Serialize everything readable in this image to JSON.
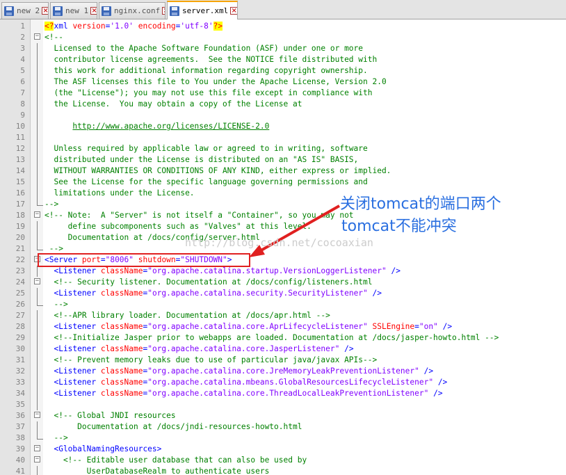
{
  "tabs": [
    {
      "label": "new 2",
      "active": false
    },
    {
      "label": "new 1",
      "active": false
    },
    {
      "label": "nginx.conf",
      "active": false
    },
    {
      "label": "server.xml",
      "active": true
    }
  ],
  "lines": [
    {
      "n": "1",
      "segs": [
        [
          "pi",
          "<?"
        ],
        [
          "tg",
          "xml "
        ],
        [
          "at",
          "version"
        ],
        [
          "tg",
          "="
        ],
        [
          "vl",
          "'1.0'"
        ],
        [
          "tg",
          " "
        ],
        [
          "at",
          "encoding"
        ],
        [
          "tg",
          "="
        ],
        [
          "vl",
          "'utf-8'"
        ],
        [
          "pi",
          "?>"
        ]
      ]
    },
    {
      "n": "2",
      "segs": [
        [
          "cm",
          "<!--"
        ]
      ]
    },
    {
      "n": "3",
      "segs": [
        [
          "cm",
          "  Licensed to the Apache Software Foundation (ASF) under one or more"
        ]
      ]
    },
    {
      "n": "4",
      "segs": [
        [
          "cm",
          "  contributor license agreements.  See the NOTICE file distributed with"
        ]
      ]
    },
    {
      "n": "5",
      "segs": [
        [
          "cm",
          "  this work for additional information regarding copyright ownership."
        ]
      ]
    },
    {
      "n": "6",
      "segs": [
        [
          "cm",
          "  The ASF licenses this file to You under the Apache License, Version 2.0"
        ]
      ]
    },
    {
      "n": "7",
      "segs": [
        [
          "cm",
          "  (the \"License\"); you may not use this file except in compliance with"
        ]
      ]
    },
    {
      "n": "8",
      "segs": [
        [
          "cm",
          "  the License.  You may obtain a copy of the License at"
        ]
      ]
    },
    {
      "n": "9",
      "segs": []
    },
    {
      "n": "10",
      "segs": [
        [
          "cm",
          "      "
        ],
        [
          "url",
          "http://www.apache.org/licenses/LICENSE-2.0"
        ]
      ]
    },
    {
      "n": "11",
      "segs": []
    },
    {
      "n": "12",
      "segs": [
        [
          "cm",
          "  Unless required by applicable law or agreed to in writing, software"
        ]
      ]
    },
    {
      "n": "13",
      "segs": [
        [
          "cm",
          "  distributed under the License is distributed on an \"AS IS\" BASIS,"
        ]
      ]
    },
    {
      "n": "14",
      "segs": [
        [
          "cm",
          "  WITHOUT WARRANTIES OR CONDITIONS OF ANY KIND, either express or implied."
        ]
      ]
    },
    {
      "n": "15",
      "segs": [
        [
          "cm",
          "  See the License for the specific language governing permissions and"
        ]
      ]
    },
    {
      "n": "16",
      "segs": [
        [
          "cm",
          "  limitations under the License."
        ]
      ]
    },
    {
      "n": "17",
      "segs": [
        [
          "cm",
          "-->"
        ]
      ]
    },
    {
      "n": "18",
      "segs": [
        [
          "cm",
          "<!-- Note:  A \"Server\" is not itself a \"Container\", so you may not"
        ]
      ]
    },
    {
      "n": "19",
      "segs": [
        [
          "cm",
          "     define subcomponents such as \"Valves\" at this level."
        ]
      ]
    },
    {
      "n": "20",
      "segs": [
        [
          "cm",
          "     Documentation at /docs/config/server.html"
        ]
      ]
    },
    {
      "n": "21",
      "segs": [
        [
          "cm",
          " -->"
        ]
      ]
    },
    {
      "n": "22",
      "segs": [
        [
          "tg",
          "<Server "
        ],
        [
          "at",
          "port"
        ],
        [
          "tg",
          "="
        ],
        [
          "vl",
          "\"8006\""
        ],
        [
          "tg",
          " "
        ],
        [
          "at",
          "shutdown"
        ],
        [
          "tg",
          "="
        ],
        [
          "vl",
          "\"SHUTDOWN\""
        ],
        [
          "tg",
          ">"
        ]
      ]
    },
    {
      "n": "23",
      "segs": [
        [
          "tg",
          "  <Listener "
        ],
        [
          "at",
          "className"
        ],
        [
          "tg",
          "="
        ],
        [
          "vl",
          "\"org.apache.catalina.startup.VersionLoggerListener\""
        ],
        [
          "tg",
          " />"
        ]
      ]
    },
    {
      "n": "24",
      "segs": [
        [
          "cm",
          "  <!-- Security listener. Documentation at /docs/config/listeners.html"
        ]
      ]
    },
    {
      "n": "25",
      "segs": [
        [
          "tg",
          "  <Listener "
        ],
        [
          "at",
          "className"
        ],
        [
          "tg",
          "="
        ],
        [
          "vl",
          "\"org.apache.catalina.security.SecurityListener\""
        ],
        [
          "tg",
          " />"
        ]
      ]
    },
    {
      "n": "26",
      "segs": [
        [
          "cm",
          "  -->"
        ]
      ]
    },
    {
      "n": "27",
      "segs": [
        [
          "cm",
          "  <!--APR library loader. Documentation at /docs/apr.html -->"
        ]
      ]
    },
    {
      "n": "28",
      "segs": [
        [
          "tg",
          "  <Listener "
        ],
        [
          "at",
          "className"
        ],
        [
          "tg",
          "="
        ],
        [
          "vl",
          "\"org.apache.catalina.core.AprLifecycleListener\""
        ],
        [
          "tg",
          " "
        ],
        [
          "at",
          "SSLEngine"
        ],
        [
          "tg",
          "="
        ],
        [
          "vl",
          "\"on\""
        ],
        [
          "tg",
          " />"
        ]
      ]
    },
    {
      "n": "29",
      "segs": [
        [
          "cm",
          "  <!--Initialize Jasper prior to webapps are loaded. Documentation at /docs/jasper-howto.html -->"
        ]
      ]
    },
    {
      "n": "30",
      "segs": [
        [
          "tg",
          "  <Listener "
        ],
        [
          "at",
          "className"
        ],
        [
          "tg",
          "="
        ],
        [
          "vl",
          "\"org.apache.catalina.core.JasperListener\""
        ],
        [
          "tg",
          " />"
        ]
      ]
    },
    {
      "n": "31",
      "segs": [
        [
          "cm",
          "  <!-- Prevent memory leaks due to use of particular java/javax APIs-->"
        ]
      ]
    },
    {
      "n": "32",
      "segs": [
        [
          "tg",
          "  <Listener "
        ],
        [
          "at",
          "className"
        ],
        [
          "tg",
          "="
        ],
        [
          "vl",
          "\"org.apache.catalina.core.JreMemoryLeakPreventionListener\""
        ],
        [
          "tg",
          " />"
        ]
      ]
    },
    {
      "n": "33",
      "segs": [
        [
          "tg",
          "  <Listener "
        ],
        [
          "at",
          "className"
        ],
        [
          "tg",
          "="
        ],
        [
          "vl",
          "\"org.apache.catalina.mbeans.GlobalResourcesLifecycleListener\""
        ],
        [
          "tg",
          " />"
        ]
      ]
    },
    {
      "n": "34",
      "segs": [
        [
          "tg",
          "  <Listener "
        ],
        [
          "at",
          "className"
        ],
        [
          "tg",
          "="
        ],
        [
          "vl",
          "\"org.apache.catalina.core.ThreadLocalLeakPreventionListener\""
        ],
        [
          "tg",
          " />"
        ]
      ]
    },
    {
      "n": "35",
      "segs": []
    },
    {
      "n": "36",
      "segs": [
        [
          "cm",
          "  <!-- Global JNDI resources"
        ]
      ]
    },
    {
      "n": "37",
      "segs": [
        [
          "cm",
          "       Documentation at /docs/jndi-resources-howto.html"
        ]
      ]
    },
    {
      "n": "38",
      "segs": [
        [
          "cm",
          "  -->"
        ]
      ]
    },
    {
      "n": "39",
      "segs": [
        [
          "tg",
          "  <GlobalNamingResources>"
        ]
      ]
    },
    {
      "n": "40",
      "segs": [
        [
          "cm",
          "    <!-- Editable user database that can also be used by"
        ]
      ]
    },
    {
      "n": "41",
      "segs": [
        [
          "cm",
          "         UserDatabaseRealm to authenticate users"
        ]
      ]
    }
  ],
  "annotation": {
    "line1": "关闭tomcat的端口两个",
    "line2": "tomcat不能冲突"
  },
  "watermark": "http://blog.csdn.net/cocoaxian",
  "colors": {
    "annotation": "#2a6fe0",
    "highlight_box": "#e02020",
    "comment": "#008000",
    "tag": "#0000ff",
    "attribute": "#ff0000",
    "value": "#8000ff"
  },
  "icons": {
    "tab": "save-icon",
    "tab_close": "close-icon"
  }
}
